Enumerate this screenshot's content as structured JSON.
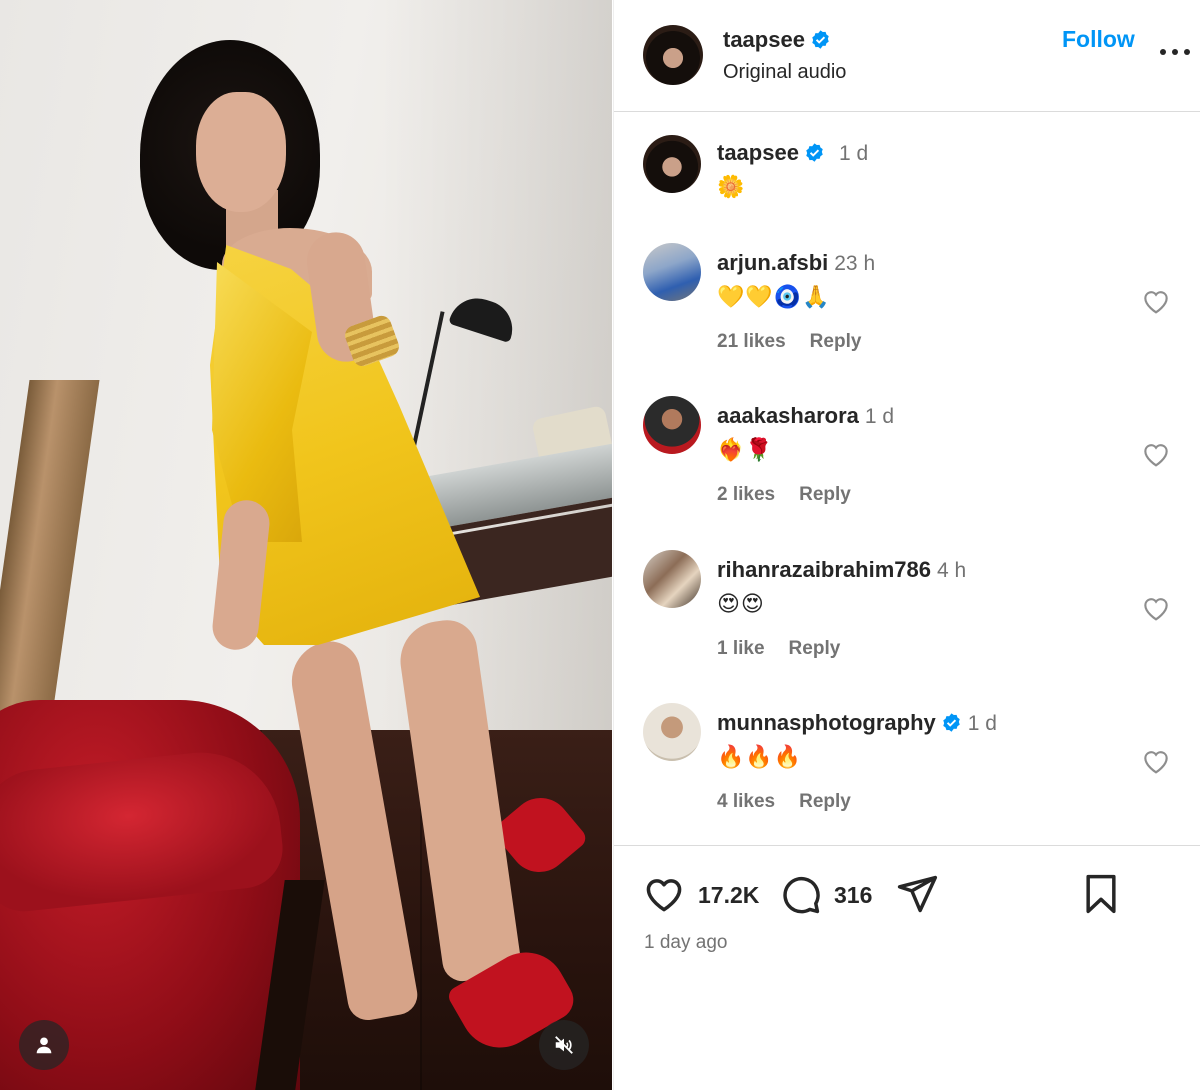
{
  "media": {
    "profile_button_icon": "user-icon",
    "mute_button_icon": "speaker-muted-icon"
  },
  "header": {
    "username": "taapsee",
    "subtitle": "Original audio",
    "follow_label": "Follow"
  },
  "caption": {
    "username": "taapsee",
    "time": "1 d",
    "text": "🌼"
  },
  "comments": [
    {
      "username": "arjun.afsbi",
      "verified": false,
      "time": "23 h",
      "text": "💛💛🧿🙏",
      "likes": "21 likes",
      "reply": "Reply"
    },
    {
      "username": "aaakasharora",
      "verified": false,
      "time": "1 d",
      "text": "❤️‍🔥🌹",
      "likes": "2 likes",
      "reply": "Reply"
    },
    {
      "username": "rihanrazaibrahim786",
      "verified": false,
      "time": "4 h",
      "text": "😍😍",
      "likes": "1 like",
      "reply": "Reply"
    },
    {
      "username": "munnasphotography",
      "verified": true,
      "time": "1 d",
      "text": "🔥🔥🔥",
      "likes": "4 likes",
      "reply": "Reply"
    }
  ],
  "footer": {
    "like_count": "17.2K",
    "comment_count": "316",
    "posted_ago": "1 day ago"
  },
  "colors": {
    "accent": "#0095f6",
    "verified": "#0095f6",
    "muted_text": "#737373",
    "divider": "#dbdbdb"
  }
}
